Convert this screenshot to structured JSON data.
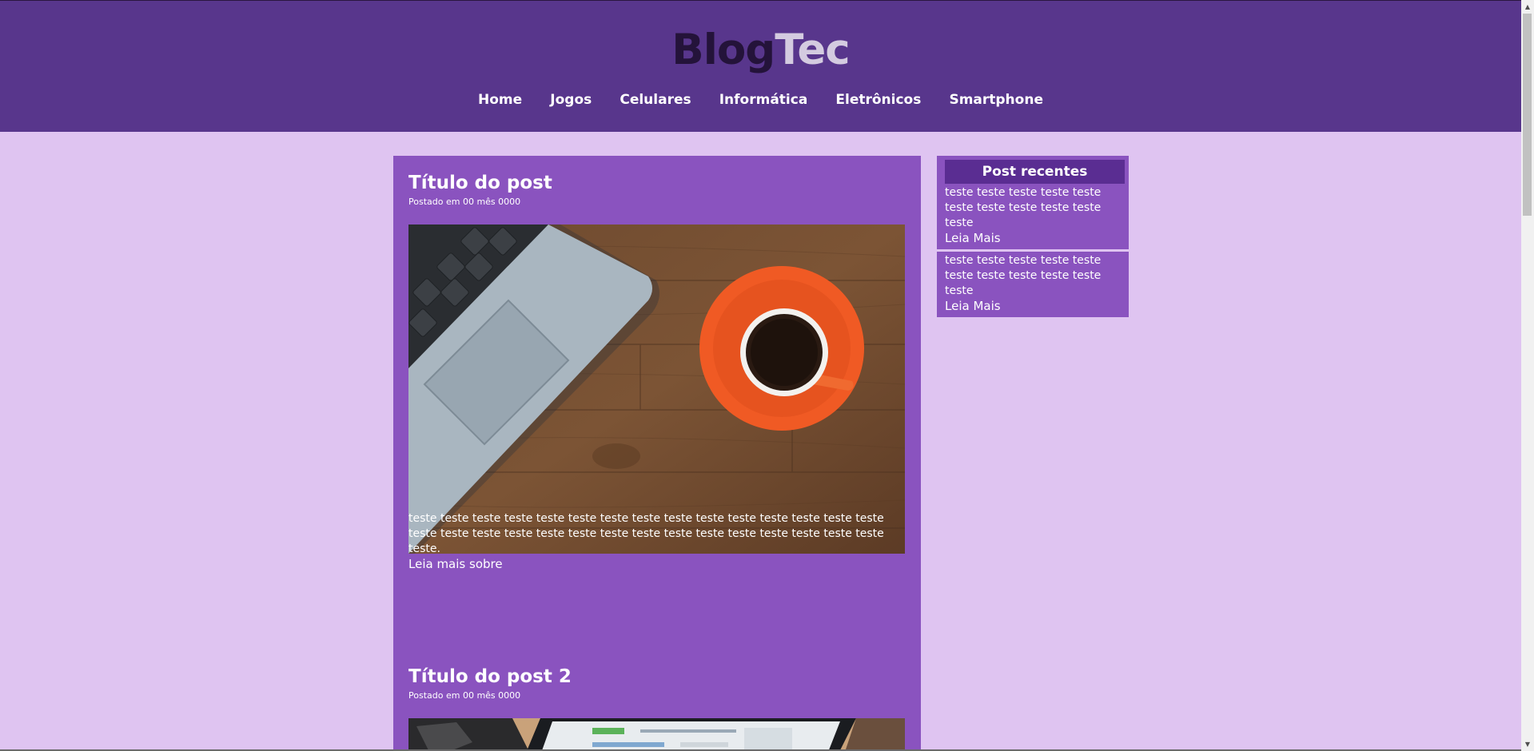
{
  "header": {
    "logo_part1": "Blog",
    "logo_part2": "Tec",
    "nav": [
      "Home",
      "Jogos",
      "Celulares",
      "Informática",
      "Eletrônicos",
      "Smartphone"
    ]
  },
  "posts": [
    {
      "title": "Título do post",
      "meta": "Postado em 00 mês 0000",
      "image": "laptop-and-coffee-photo",
      "text": "teste teste teste teste teste teste teste teste teste teste teste teste teste teste teste teste teste teste teste teste teste teste teste teste teste teste teste teste teste teste teste.",
      "more": "Leia mais sobre"
    },
    {
      "title": "Título do post 2",
      "meta": "Postado em 00 mês 0000",
      "image": "laptop-screen-photo"
    }
  ],
  "sidebar": {
    "title": "Post recentes",
    "items": [
      {
        "text": "teste teste teste teste teste teste teste teste teste teste teste",
        "more": "Leia Mais"
      },
      {
        "text": "teste teste teste teste teste teste teste teste teste teste teste",
        "more": "Leia Mais"
      }
    ]
  },
  "colors": {
    "page_bg": "#dfc4f1",
    "header_bg": "#58368c",
    "panel_bg": "#8a53bf",
    "sidebar_head_bg": "#5a2d92",
    "logo_dark": "#24133a",
    "logo_light": "#d4cbe0"
  }
}
